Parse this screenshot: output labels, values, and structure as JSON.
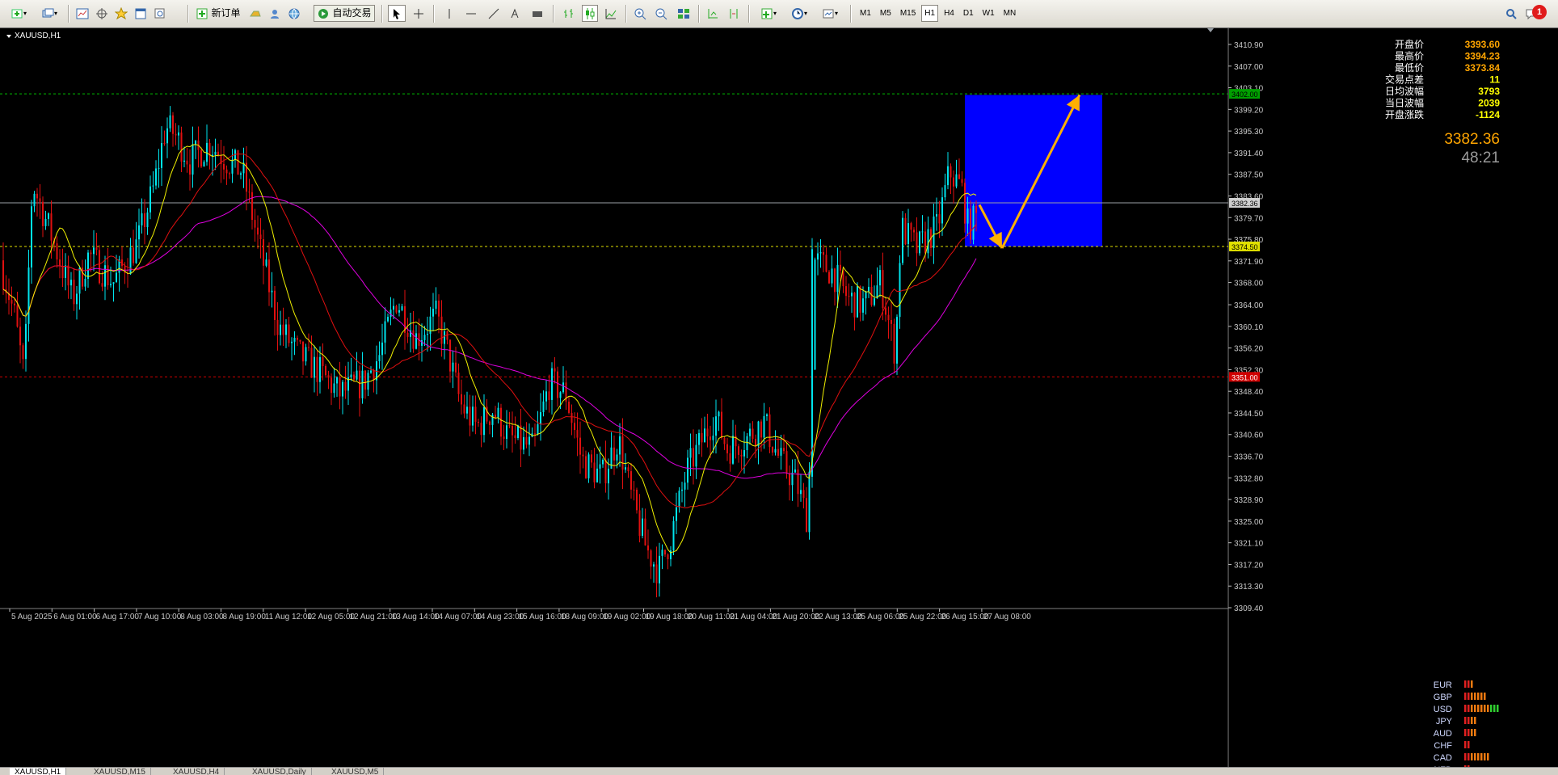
{
  "toolbar": {
    "new_order_label": "新订单",
    "autotrade_label": "自动交易",
    "timeframes": [
      "M1",
      "M5",
      "M15",
      "H1",
      "H4",
      "D1",
      "W1",
      "MN"
    ],
    "active_timeframe": "H1",
    "alert_badge": "1"
  },
  "chart": {
    "symbol_label": "XAUUSD,H1",
    "info_panel": [
      {
        "label": "开盘价",
        "value": "3393.60",
        "color": "#ffa500"
      },
      {
        "label": "最高价",
        "value": "3394.23",
        "color": "#ffa500"
      },
      {
        "label": "最低价",
        "value": "3373.84",
        "color": "#ffa500"
      },
      {
        "label": "交易点差",
        "value": "11",
        "color": "#ffff00"
      },
      {
        "label": "日均波幅",
        "value": "3793",
        "color": "#ffff00"
      },
      {
        "label": "当日波幅",
        "value": "2039",
        "color": "#ffff00"
      },
      {
        "label": "开盘涨跌",
        "value": "-1124",
        "color": "#ffff00"
      }
    ],
    "current_price": "3382.36",
    "countdown": "48:21",
    "price_axis": [
      "3410.90",
      "3407.00",
      "3403.10",
      "3399.20",
      "3395.30",
      "3391.40",
      "3387.50",
      "3383.60",
      "3379.70",
      "3375.80",
      "3371.90",
      "3368.00",
      "3364.00",
      "3360.10",
      "3356.20",
      "3352.30",
      "3348.40",
      "3344.50",
      "3340.60",
      "3336.70",
      "3332.80",
      "3328.90",
      "3325.00",
      "3321.10",
      "3317.20",
      "3313.30",
      "3309.40"
    ],
    "price_axis_labels": {
      "green_line": "3402.00",
      "current": "3382.36",
      "yellow_line": "3374.50",
      "red_line": "3351.00"
    },
    "time_axis": [
      "5 Aug 2025",
      "6 Aug 01:00",
      "6 Aug 17:00",
      "7 Aug 10:00",
      "8 Aug 03:00",
      "8 Aug 19:00",
      "11 Aug 12:00",
      "12 Aug 05:00",
      "12 Aug 21:00",
      "13 Aug 14:00",
      "14 Aug 07:00",
      "14 Aug 23:00",
      "15 Aug 16:00",
      "18 Aug 09:00",
      "19 Aug 02:00",
      "19 Aug 18:00",
      "20 Aug 11:00",
      "21 Aug 04:00",
      "21 Aug 20:00",
      "22 Aug 13:00",
      "25 Aug 06:00",
      "25 Aug 22:00",
      "26 Aug 15:00",
      "27 Aug 08:00"
    ],
    "currency_strength": [
      {
        "name": "EUR",
        "bars": 3
      },
      {
        "name": "GBP",
        "bars": 7
      },
      {
        "name": "USD",
        "bars": 11
      },
      {
        "name": "JPY",
        "bars": 4
      },
      {
        "name": "AUD",
        "bars": 4
      },
      {
        "name": "CHF",
        "bars": 2
      },
      {
        "name": "CAD",
        "bars": 8
      },
      {
        "name": "NZD",
        "bars": 2
      }
    ],
    "colors": {
      "bull": "#00e5ee",
      "bear": "#e01010",
      "ma_fast": "#f0f000",
      "ma_mid": "#e01010",
      "ma_slow": "#e000e0",
      "zone": "#0000ff",
      "arrow": "#ffb000"
    }
  },
  "bottom_tabs": [
    "XAUUSD,H1",
    "XAUUSD,M15",
    "XAUUSD,H4",
    "XAUUSD,Daily",
    "XAUUSD,M5"
  ]
}
